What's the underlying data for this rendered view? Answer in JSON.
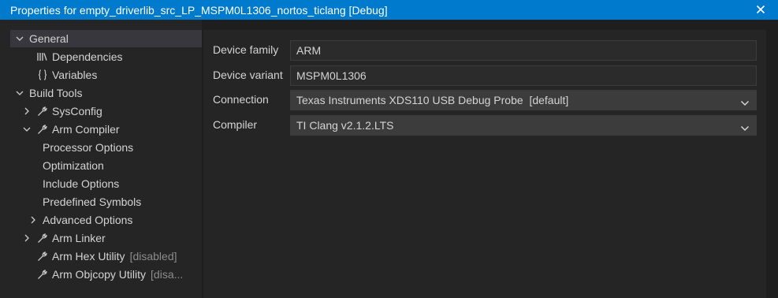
{
  "window": {
    "title": "Properties for empty_driverlib_src_LP_MSPM0L1306_nortos_ticlang [Debug]"
  },
  "tree": {
    "general": "General",
    "dependencies": "Dependencies",
    "variables": "Variables",
    "build_tools": "Build Tools",
    "sysconfig": "SysConfig",
    "arm_compiler": "Arm Compiler",
    "processor_options": "Processor Options",
    "optimization": "Optimization",
    "include_options": "Include Options",
    "predefined_symbols": "Predefined Symbols",
    "advanced_options": "Advanced Options",
    "arm_linker": "Arm Linker",
    "arm_hex_utility": "Arm Hex Utility",
    "arm_hex_utility_status": "[disabled]",
    "arm_objcopy_utility": "Arm Objcopy Utility",
    "arm_objcopy_utility_status": "[disa..."
  },
  "form": {
    "device_family_label": "Device family",
    "device_family_value": "ARM",
    "device_variant_label": "Device variant",
    "device_variant_value": "MSPM0L1306",
    "connection_label": "Connection",
    "connection_value": "Texas Instruments XDS110 USB Debug Probe  [default]",
    "compiler_label": "Compiler",
    "compiler_value": "TI Clang v2.1.2.LTS"
  }
}
